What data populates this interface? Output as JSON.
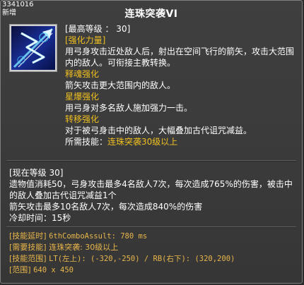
{
  "tooltip": {
    "skill_id": "3341016",
    "status": "新增",
    "title": "连珠突袭VI"
  },
  "icon": {
    "name": "lightning-arrow-skill-icon"
  },
  "description": {
    "max_level": "[最高等级 ： 30]",
    "sections": [
      {
        "header": "[强化力量]",
        "text": "用弓身攻击近处敌人后，射出在空间飞行的箭矢，攻击大范围内的敌人。可衔接主教转换。"
      },
      {
        "header": "释魂强化",
        "text": "箭矢攻击更大范围内的敌人。"
      },
      {
        "header": "星爆强化",
        "text": "用弓身对多名敌人施加强力一击。"
      },
      {
        "header": "转移强化",
        "text": "对于被弓身击中的敌人，大幅叠加古代诅咒减益。"
      }
    ],
    "required_prefix": "所需技能：",
    "required_value": "连珠突袭30级以上"
  },
  "current_level": {
    "header": "[现在等级 30]",
    "line1": "遗物值消耗50，弓身攻击最多4名敌人7次，每次造成765%的伤害，被击中的敌人叠加古代诅咒减益1个",
    "line2": "箭矢攻击最多10名敌人7次，每次造成840%的伤害",
    "line3": "冷却时间：15秒"
  },
  "debug": {
    "delay_label": "[技能延时]",
    "delay_value": "6thComboAssult: 780 ms",
    "required_label": "[需要技能]",
    "required_value": "连珠突袭: 30级以上",
    "range_label": "[技能范围]",
    "range_value": "LT(左上): (-320,-250) / RB(右下): (320,200)",
    "area_label": "[范围]",
    "area_value": "640 x 450"
  },
  "colors": {
    "background": "#3c3c3c",
    "highlight": "#f0c020",
    "text": "#ffffff",
    "debug": "#e8b64a"
  }
}
